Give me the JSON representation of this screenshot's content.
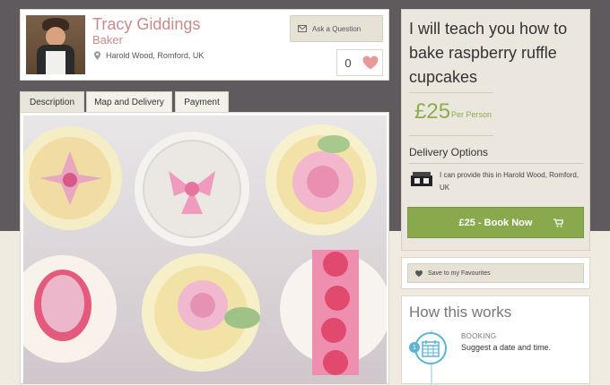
{
  "profile": {
    "name": "Tracy Giddings",
    "role": "Baker",
    "location": "Harold Wood, Romford, UK",
    "ask_label": "Ask a Question",
    "favourite_count": "0"
  },
  "tabs": [
    {
      "label": "Description"
    },
    {
      "label": "Map and Delivery"
    },
    {
      "label": "Payment"
    }
  ],
  "listing": {
    "title": "I will teach you how to bake raspberry ruffle cupcakes",
    "price": "£25",
    "price_unit": "Per Person",
    "delivery_heading": "Delivery Options",
    "delivery_text": "I can provide this in Harold Wood, Romford, UK",
    "book_label": "£25 - Book Now"
  },
  "favourites": {
    "save_label": "Save to my Favourites"
  },
  "how_it_works": {
    "title": "How this works",
    "steps": [
      {
        "number": "1",
        "title": "BOOKING",
        "description": "Suggest a date and time."
      }
    ]
  },
  "colors": {
    "accent_green": "#8aa84c",
    "name_pink": "#c98a8a",
    "step_blue": "#59b5d2"
  }
}
